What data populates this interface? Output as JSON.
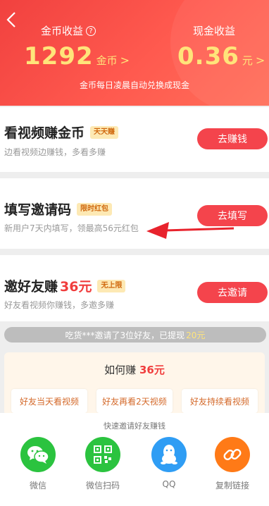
{
  "header": {
    "gold_label": "金币收益",
    "help_glyph": "?",
    "gold_value": "1292",
    "gold_unit": "金币",
    "cash_label": "现金收益",
    "cash_value": "0.36",
    "cash_unit": "元",
    "chevron": ">",
    "note": "金币每日凌晨自动兑换成现金"
  },
  "cards": [
    {
      "title": "看视频赚金币",
      "tag": "天天赚",
      "subtitle": "边看视频边赚钱，多看多赚",
      "button": "去赚钱"
    },
    {
      "title": "填写邀请码",
      "tag": "限时红包",
      "subtitle": "新用户7天内填写，领最高56元红包",
      "button": "去填写"
    },
    {
      "title": "邀好友赚",
      "amount": "36元",
      "tag": "无上限",
      "subtitle": "好友看视频你赚钱，多邀多赚",
      "button": "去邀请"
    }
  ],
  "invite_status": {
    "text": "吃货***邀请了3位好友，已提现",
    "amount": "20元"
  },
  "howto": {
    "title": "如何赚",
    "amount": "36元",
    "steps": [
      "好友当天看视频",
      "好友再看2天视频",
      "好友持续看视频"
    ]
  },
  "share": {
    "title": "快速邀请好友赚钱",
    "items": [
      {
        "label": "微信",
        "icon": "wechat-icon",
        "color": "#2bc33f"
      },
      {
        "label": "微信扫码",
        "icon": "qr-code-icon",
        "color": "#2bc33f"
      },
      {
        "label": "QQ",
        "icon": "qq-icon",
        "color": "#2f9df4"
      },
      {
        "label": "复制链接",
        "icon": "link-icon",
        "color": "#ff7a17"
      }
    ]
  },
  "colors": {
    "accent": "#f4444c",
    "gold": "#ffe47a",
    "tag_bg": "#fde9b4"
  }
}
